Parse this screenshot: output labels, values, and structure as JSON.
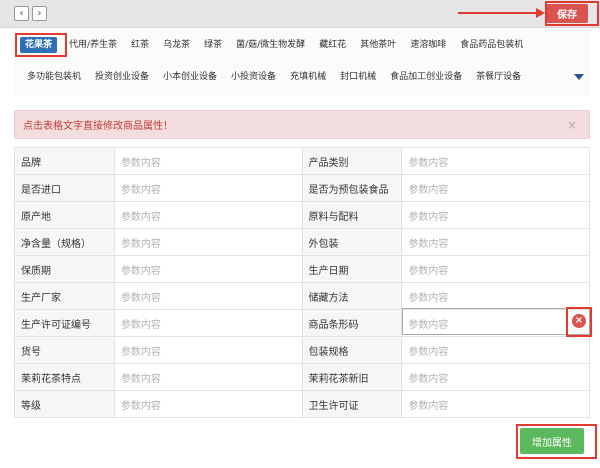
{
  "toolbar": {
    "prev_icon": "‹",
    "next_icon": "›",
    "save_label": "保存"
  },
  "categories_row1": [
    "花果茶",
    "代用/养生茶",
    "红茶",
    "乌龙茶",
    "绿茶",
    "菌/菇/微生物发酵",
    "藏红花",
    "其他茶叶",
    "速溶咖啡",
    "食品药品包装机"
  ],
  "categories_row2": [
    "多功能包装机",
    "投资创业设备",
    "小本创业设备",
    "小投资设备",
    "充填机械",
    "封口机械",
    "食品加工创业设备",
    "茶餐厅设备"
  ],
  "active_category": "花果茶",
  "alert": {
    "text": "点击表格文字直接修改商品属性！",
    "close": "×"
  },
  "table": {
    "placeholder": "参数内容",
    "rows": [
      [
        "品牌",
        "产品类别"
      ],
      [
        "是否进口",
        "是否为预包装食品"
      ],
      [
        "原产地",
        "原料与配料"
      ],
      [
        "净含量（规格）",
        "外包装"
      ],
      [
        "保质期",
        "生产日期"
      ],
      [
        "生产厂家",
        "储藏方法"
      ],
      [
        "生产许可证编号",
        "商品条形码"
      ],
      [
        "货号",
        "包装规格"
      ],
      [
        "茉莉花茶特点",
        "茉莉花茶新旧"
      ],
      [
        "等级",
        "卫生许可证"
      ]
    ]
  },
  "delete_icon": "×",
  "add_button_label": "增加属性",
  "colors": {
    "save": "#d9534f",
    "active_category": "#2f6fb3",
    "add": "#5cb85c",
    "highlight": "#e23a2f"
  }
}
